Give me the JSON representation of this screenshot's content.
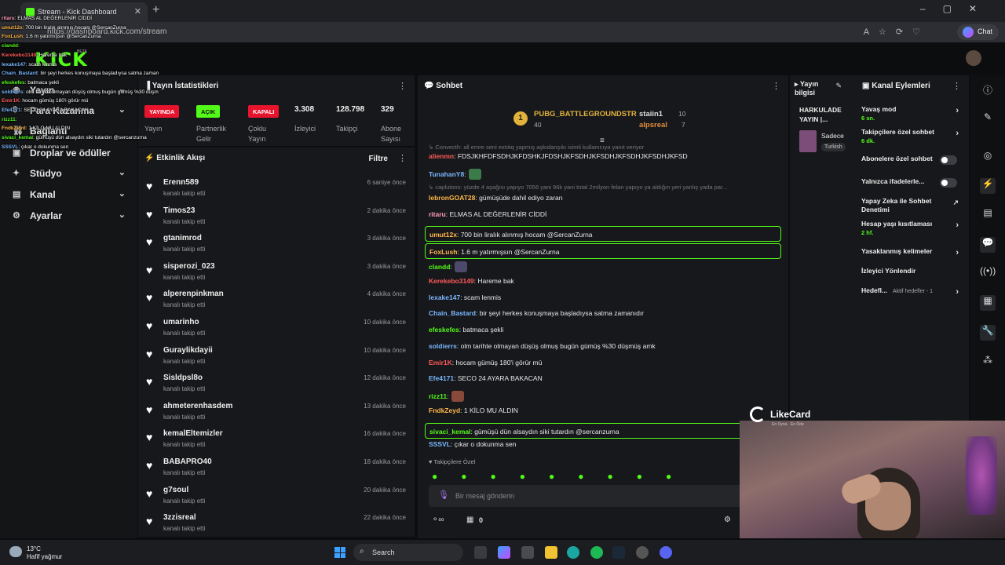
{
  "browser": {
    "tab_title": "Stream - Kick Dashboard",
    "url": "https://dashboard.kick.com/stream",
    "chat_button": "Chat"
  },
  "header": {
    "logo": "KICK",
    "beta": "BETA"
  },
  "leftnav": {
    "items": [
      {
        "label": "Yayın",
        "icon": "broadcast-icon"
      },
      {
        "label": "Para Kazanma",
        "icon": "money-icon"
      },
      {
        "label": "Bağlantı",
        "icon": "link-icon"
      },
      {
        "label": "Droplar ve ödüller",
        "icon": "gift-icon"
      },
      {
        "label": "Stüdyo",
        "icon": "studio-icon"
      },
      {
        "label": "Kanal",
        "icon": "channel-icon"
      },
      {
        "label": "Ayarlar",
        "icon": "gear-icon"
      }
    ]
  },
  "overlay_chat": [
    {
      "user": "ritaru",
      "text": ": ELMAS AL DEĞERLENİR CİDDİ",
      "color": "#ff9eb5"
    },
    {
      "user": "umut12x",
      "text": ": 700 bin liralık alınmış hocam @SercanZurna",
      "color": "#ffb84a"
    },
    {
      "user": "FoxLush",
      "text": ": 1.6 m yatırmışsın @SercanZurna",
      "color": "#ffb84a"
    },
    {
      "user": "clandd",
      "text": ":",
      "color": "#53fc18"
    },
    {
      "user": "Kerekebo3149",
      "text": ": Hareme bak",
      "color": "#ff5a5a"
    },
    {
      "user": "lexake147",
      "text": ": scam lenmis",
      "color": "#7ab8ff"
    },
    {
      "user": "Chain_Bastard",
      "text": ": bir şeyi herkes konuşmaya başladıysa satma zaman",
      "color": "#7ab8ff"
    },
    {
      "user": "efeskefes",
      "text": ": batmaca şekli",
      "color": "#53fc18"
    },
    {
      "user": "soldierrs",
      "text": ": olm tarihte olmayan düşüş olmuş bugün gümüş %30 düşm",
      "color": "#7ab8ff"
    },
    {
      "user": "Emir1K",
      "text": ": hocam gümüş 180'i görür mü",
      "color": "#ff5a5a"
    },
    {
      "user": "Efe4171",
      "text": ": SECO 24 AYARA BAKACAN",
      "color": "#7ab8ff"
    },
    {
      "user": "rizz11",
      "text": ":",
      "color": "#53fc18"
    },
    {
      "user": "FndkZeyd",
      "text": ": 1 KİLO MU ALDIN",
      "color": "#ffb84a"
    },
    {
      "user": "sivaci_kemal",
      "text": ": gümüşü dün alsaydın siki tutardın @sercanzurna",
      "color": "#53fc18"
    },
    {
      "user": "SSSVL",
      "text": ": çıkar o dokunma sen",
      "color": "#7ab8ff"
    }
  ],
  "stats": {
    "title": "Yayın İstatistikleri",
    "items": [
      {
        "value": "YAYINDA",
        "label": "Yayın",
        "type": "red"
      },
      {
        "value": "AÇIK",
        "label": "Partnerlik Gelir",
        "type": "green"
      },
      {
        "value": "KAPALI",
        "label": "Çoklu Yayın",
        "type": "red"
      },
      {
        "value": "3.308",
        "label": "İzleyici",
        "type": "num"
      },
      {
        "value": "128.798",
        "label": "Takipçi",
        "type": "num"
      },
      {
        "value": "329",
        "label": "Abone Sayısı",
        "type": "num"
      }
    ]
  },
  "events": {
    "title": "Etkinlik Akışı",
    "filter": "Filtre",
    "sub": "kanalı takip etti",
    "items": [
      {
        "name": "Erenn589",
        "time": "6 saniye önce"
      },
      {
        "name": "Timos23",
        "time": "2 dakika önce"
      },
      {
        "name": "gtanimrod",
        "time": "3 dakika önce"
      },
      {
        "name": "sisperozi_023",
        "time": "3 dakika önce"
      },
      {
        "name": "alperenpinkman",
        "time": "4 dakika önce"
      },
      {
        "name": "umarinho",
        "time": "10 dakika önce"
      },
      {
        "name": "Guraylikdayii",
        "time": "10 dakika önce"
      },
      {
        "name": "Sisldpsl8o",
        "time": "12 dakika önce"
      },
      {
        "name": "ahmeterenhasdem",
        "time": "13 dakika önce"
      },
      {
        "name": "kemalEltemizler",
        "time": "16 dakika önce"
      },
      {
        "name": "BABAPRO40",
        "time": "18 dakika önce"
      },
      {
        "name": "g7soul",
        "time": "20 dakika önce"
      },
      {
        "name": "3zzisreal",
        "time": "22 dakika önce"
      }
    ]
  },
  "chat": {
    "title": "Sohbet",
    "pinned": {
      "first": {
        "name": "PUBG_BATTLEGROUNDSTR",
        "count": "40"
      },
      "others": [
        {
          "name": "staiin1",
          "count": "10"
        },
        {
          "name": "alpsreal",
          "count": "7"
        }
      ]
    },
    "reply1": "↳ Convecth: all emre seni extıtiq yapmış aşkıdanşıkı isimli kullanıcıya yanıt veriyor",
    "messages_top": [
      {
        "user": "alienmn",
        "text": ": FDSJKHFDFSDHJKFDSHKJFDSHJKFSDHJKFSDHJKFSDHJKFSDHJKFSD",
        "color": "#ff5a5a"
      },
      {
        "user": "TunahanY8",
        "text": ":",
        "color": "#7ab8ff"
      }
    ],
    "reply2": "↳ caplutons: yüzde 4 aşağısı yapıyo 7056 yani 96k yani total 2milyon felan yapıyo ya aldığın yeri yanlış yada par...",
    "messages": [
      {
        "user": "lebronGOAT28",
        "text": ": gümüşüde dahil ediyo zararı",
        "color": "#ffb84a",
        "hl": false
      },
      {
        "user": "ritaru",
        "text": ": ELMAS AL DEĞERLENİR CİDDİ",
        "color": "#ff9eb5",
        "hl": false
      },
      {
        "user": "umut12x",
        "text": ": 700 bin liralık alınmış hocam @SercanZurna",
        "color": "#ffb84a",
        "hl": true
      },
      {
        "user": "FoxLush",
        "text": ": 1.6 m yatırmışsın @SercanZurna",
        "color": "#ffb84a",
        "hl": true
      },
      {
        "user": "clandd",
        "text": ":",
        "color": "#53fc18",
        "hl": false
      },
      {
        "user": "Kerekebo3149",
        "text": ": Hareme bak",
        "color": "#ff5a5a",
        "hl": false
      },
      {
        "user": "lexake147",
        "text": ": scam lenmis",
        "color": "#7ab8ff",
        "hl": false
      },
      {
        "user": "Chain_Bastard",
        "text": ": bir şeyi herkes konuşmaya başladıysa satma zamanıdır",
        "color": "#7ab8ff",
        "hl": false
      },
      {
        "user": "efeskefes",
        "text": ": batmaca şekli",
        "color": "#53fc18",
        "hl": false
      },
      {
        "user": "soldierrs",
        "text": ": olm tarihte olmayan düşüş olmuş bugün gümüş %30 düşmüş amk",
        "color": "#7ab8ff",
        "hl": false
      },
      {
        "user": "Emir1K",
        "text": ": hocam gümüş 180'i görür mü",
        "color": "#ff5a5a",
        "hl": false
      },
      {
        "user": "Efe4171",
        "text": ": SECO 24 AYARA BAKACAN",
        "color": "#7ab8ff",
        "hl": false
      },
      {
        "user": "rizz11",
        "text": ":",
        "color": "#53fc18",
        "hl": false
      },
      {
        "user": "FndkZeyd",
        "text": ": 1 KİLO MU ALDIN",
        "color": "#ffb84a",
        "hl": false
      },
      {
        "user": "sivaci_kemal",
        "text": ": gümüşü dün alsaydın siki tutardın @sercanzurna",
        "color": "#53fc18",
        "hl": true
      },
      {
        "user": "SSSVL",
        "text": ": çıkar o dokunma sen",
        "color": "#7ab8ff",
        "hl": false
      }
    ],
    "followers_only": "Takipçilere Özel",
    "placeholder": "Bir mesaj gönderin",
    "points": "0"
  },
  "info": {
    "title": "Yayın bilgisi",
    "stream_title": "HARKULADE YAYIN |...",
    "category": "Sadece",
    "tag": "Turkish"
  },
  "actions": {
    "title": "Kanal Eylemleri",
    "items": [
      {
        "label": "Yavaş mod",
        "sub": "6 sn.",
        "control": "arrow"
      },
      {
        "label": "Takipçilere özel sohbet",
        "sub": "6 dk.",
        "control": "arrow"
      },
      {
        "label": "Abonelere özel sohbet",
        "sub": "",
        "control": "toggle"
      },
      {
        "label": "Yalnızca ifadelerle...",
        "sub": "",
        "control": "toggle"
      },
      {
        "label": "Yapay Zeka ile Sohbet Denetimi",
        "sub": "",
        "control": "link"
      },
      {
        "label": "Hesap yaşı kısıtlaması",
        "sub": "2 hf.",
        "control": "arrow"
      },
      {
        "label": "Yasaklanmış kelimeler",
        "sub": "",
        "control": "arrow"
      },
      {
        "label": "İzleyici Yönlendir",
        "sub": "",
        "control": "none"
      },
      {
        "label": "Hedefl...",
        "sub": "Aktif hedefler - 1",
        "control": "arrow"
      }
    ]
  },
  "overlay_brand": {
    "name": "LikeCard",
    "tagline": "En Oyna · En Öde"
  },
  "taskbar": {
    "temp": "13°C",
    "weather": "Hafif yağmur",
    "search": "Search"
  }
}
